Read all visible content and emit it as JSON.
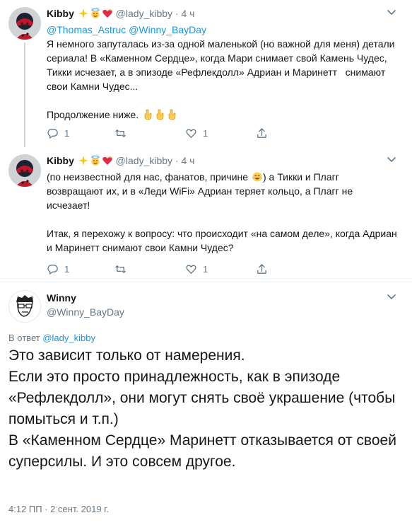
{
  "tweets": [
    {
      "name": "Kibby",
      "emojis": [
        "sparkles-emoji",
        "halo-face-emoji",
        "sparkling-heart-emoji"
      ],
      "handle": "@lady_kibby",
      "sep": "·",
      "time": "4 ч",
      "mention1": "@Thomas_Astruc",
      "mention2": "@Winny_BayDay",
      "text": "Я немного запуталась из-за одной маленькой (но важной для меня) детали сериала! В «Каменном Сердце», когда Мари снимает свой Камень Чудес, Тикки исчезает, а в эпизоде «Рефлекдолл» Адриан и Маринетт   снимают свои Камни Чудес...\n\nПродолжение ниже.",
      "trailing_emoji": "pointing-down-emoji",
      "reply_count": "1",
      "retweet_count": "",
      "like_count": "1"
    },
    {
      "name": "Kibby",
      "emojis": [
        "sparkles-emoji",
        "halo-face-emoji",
        "sparkling-heart-emoji"
      ],
      "handle": "@lady_kibby",
      "sep": "·",
      "time": "4 ч",
      "text_part1": "(по неизвестной для нас, фанатов, причине ",
      "text_part2": ") а Тикки и Плагг возвращают их, и в «Леди WiFi» Адриан теряет кольцо, а Плагг не исчезает!\n\nИтак, я перехожу к вопросу: что происходит «на самом деле», когда Адриан и Маринетт снимают свои Камни Чудес?",
      "reply_count": "1",
      "retweet_count": "",
      "like_count": "1"
    }
  ],
  "main_tweet": {
    "name": "Winny",
    "handle": "@Winny_BayDay",
    "reply_to_label": "В ответ",
    "reply_to_handle": "@lady_kibby",
    "text": "Это зависит только от намерения.\nЕсли это просто принадлежность, как в эпизоде «Рефлекдолл», они могут снять своё украшение (чтобы помыться и т.п.)\nВ «Каменном Сердце» Маринетт отказывается от своей суперсилы. И это совсем другое.",
    "timestamp": "4:12 ПП · 2 сент. 2019 г."
  },
  "colors": {
    "text": "#14171a",
    "secondary": "#657786",
    "link": "#1b95e0",
    "thread_line": "#ccd6dd",
    "divider": "#e6ecf0"
  },
  "icons": [
    "reply-icon",
    "retweet-icon",
    "like-icon",
    "share-icon",
    "chevron-down-icon"
  ]
}
